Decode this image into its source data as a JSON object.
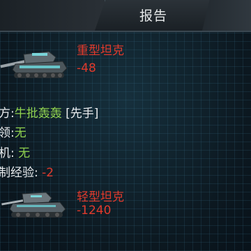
{
  "header": {
    "title": "报告"
  },
  "units": [
    {
      "name": "重型坦克",
      "delta": "-48",
      "icon": "heavy-tank-icon"
    },
    {
      "name": "轻型坦克",
      "delta": "-1240",
      "icon": "light-tank-icon"
    }
  ],
  "info": {
    "side_label": "方:",
    "side_value": "牛批轰轰",
    "side_tag": "[先手]",
    "leader_label": "领:",
    "leader_value": "无",
    "machine_label": "机:",
    "machine_value": "无",
    "exp_label": "制经验:",
    "exp_value": "-2"
  },
  "colors": {
    "loss": "#e03a2c",
    "highlight": "#8fd14f"
  }
}
